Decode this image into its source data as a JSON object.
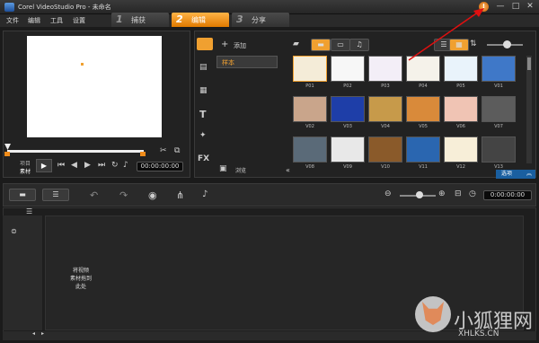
{
  "window": {
    "title": "Corel VideoStudio Pro - 未命名",
    "help_glyph": "!",
    "minimize_glyph": "—",
    "maximize_glyph": "□",
    "close_glyph": "✕"
  },
  "menu": [
    "文件",
    "编辑",
    "工具",
    "设置"
  ],
  "steps": [
    {
      "num": "1",
      "label": "捕获"
    },
    {
      "num": "2",
      "label": "编辑"
    },
    {
      "num": "3",
      "label": "分享"
    }
  ],
  "preview": {
    "project_label": "项目",
    "clip_label": "素材",
    "timecode": "00:00:00:00"
  },
  "library": {
    "add_label": "添加",
    "category": "样本",
    "browse_label": "浏览",
    "options_label": "选项",
    "side_icons": [
      "media-icon",
      "transition-icon",
      "title-icon",
      "graphic-icon",
      "filter-icon"
    ],
    "fx_label": "FX",
    "title_glyph": "T",
    "thumbnails": [
      {
        "label": "P01",
        "color": "#f4ecd8"
      },
      {
        "label": "P02",
        "color": "#f7f7f7"
      },
      {
        "label": "P03",
        "color": "#f3eef7"
      },
      {
        "label": "P04",
        "color": "#f5f2ea"
      },
      {
        "label": "P05",
        "color": "#e9f3fb"
      },
      {
        "label": "V01",
        "color": "#3f78c8"
      },
      {
        "label": "V02",
        "color": "#c9a58b"
      },
      {
        "label": "V03",
        "color": "#1e3ea8"
      },
      {
        "label": "V04",
        "color": "#c79a4a"
      },
      {
        "label": "V05",
        "color": "#d98a3a"
      },
      {
        "label": "V06",
        "color": "#f0c4b4"
      },
      {
        "label": "V07",
        "color": "#5c5c5c"
      },
      {
        "label": "V08",
        "color": "#5a6a78"
      },
      {
        "label": "V09",
        "color": "#e8e8e8"
      },
      {
        "label": "V10",
        "color": "#8a5a2a"
      },
      {
        "label": "V11",
        "color": "#2a66b0"
      },
      {
        "label": "V12",
        "color": "#f7eed8"
      },
      {
        "label": "V13",
        "color": "#444444"
      }
    ]
  },
  "timeline": {
    "timecode": "0:00:00:00",
    "drop_hint": "将视频\n素材拖到\n此处"
  },
  "watermark": {
    "text": "小狐狸网",
    "sub": "XHLKS.CN"
  }
}
